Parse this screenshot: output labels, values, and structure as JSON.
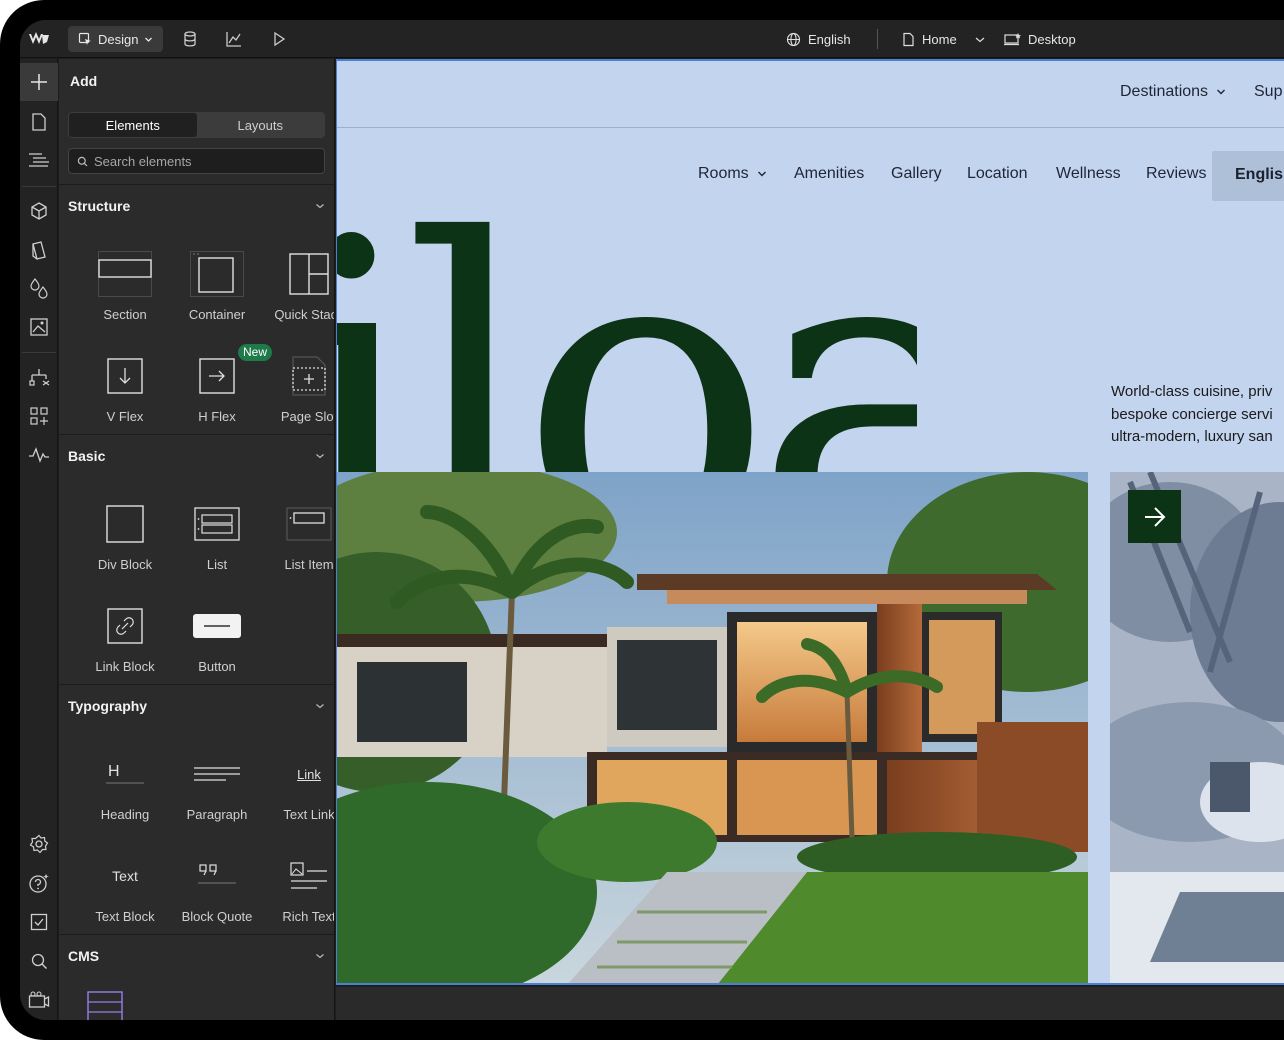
{
  "topbar": {
    "mode_label": "Design",
    "language": "English",
    "page": "Home",
    "breakpoint": "Desktop"
  },
  "panel": {
    "title": "Add",
    "tabs": [
      "Elements",
      "Layouts"
    ],
    "search_placeholder": "Search elements",
    "new_badge": "New",
    "sections": {
      "structure": {
        "title": "Structure",
        "items": [
          "Section",
          "Container",
          "Quick Stack",
          "V Flex",
          "H Flex",
          "Page Slot"
        ]
      },
      "basic": {
        "title": "Basic",
        "items": [
          "Div Block",
          "List",
          "List Item",
          "Link Block",
          "Button"
        ]
      },
      "typography": {
        "title": "Typography",
        "items": [
          "Heading",
          "Paragraph",
          "Text Link",
          "Text Block",
          "Block Quote",
          "Rich Text"
        ],
        "icon_text": {
          "heading": "H",
          "link": "Link",
          "text": "Text"
        }
      },
      "cms": {
        "title": "CMS"
      }
    }
  },
  "site": {
    "nav_top": {
      "destinations": "Destinations",
      "support": "Sup"
    },
    "nav_main": [
      "Rooms",
      "Amenities",
      "Gallery",
      "Location",
      "Wellness",
      "Reviews"
    ],
    "language_button": "English",
    "brand_word": "iloa",
    "tagline_lines": [
      "World-class cuisine, priv",
      "bespoke concierge servi",
      "ultra-modern, luxury san"
    ]
  },
  "colors": {
    "canvas_bg": "#c3d4ef",
    "brand_green": "#0d3317",
    "badge_green": "#1f7a4a",
    "selection_blue": "#4a7fd4"
  }
}
